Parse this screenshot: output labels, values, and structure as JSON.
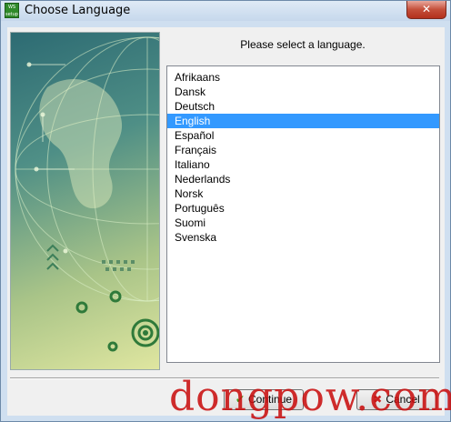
{
  "window": {
    "title": "Choose Language",
    "app_icon_text": "WS setup",
    "close_glyph": "✕"
  },
  "prompt": "Please select a language.",
  "languages": [
    {
      "label": "Afrikaans",
      "selected": false
    },
    {
      "label": "Dansk",
      "selected": false
    },
    {
      "label": "Deutsch",
      "selected": false
    },
    {
      "label": "English",
      "selected": true
    },
    {
      "label": "Español",
      "selected": false
    },
    {
      "label": "Français",
      "selected": false
    },
    {
      "label": "Italiano",
      "selected": false
    },
    {
      "label": "Nederlands",
      "selected": false
    },
    {
      "label": "Norsk",
      "selected": false
    },
    {
      "label": "Português",
      "selected": false
    },
    {
      "label": "Suomi",
      "selected": false
    },
    {
      "label": "Svenska",
      "selected": false
    }
  ],
  "buttons": {
    "continue_label": "Continue",
    "continue_icon": "check-icon",
    "cancel_label": "Cancel",
    "cancel_icon": "x-icon"
  },
  "watermark": "dongpow.com",
  "colors": {
    "selection": "#3399ff",
    "watermark": "#c80f0f"
  }
}
